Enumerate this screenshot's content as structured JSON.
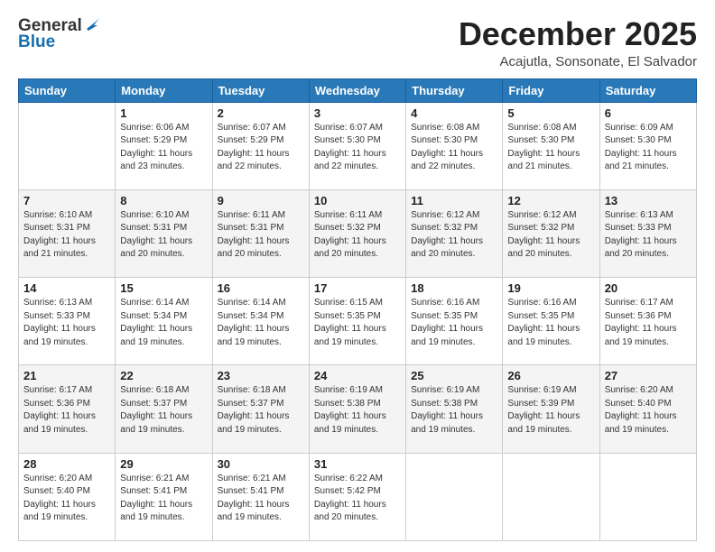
{
  "logo": {
    "line1": "General",
    "line2": "Blue"
  },
  "title": "December 2025",
  "subtitle": "Acajutla, Sonsonate, El Salvador",
  "days_of_week": [
    "Sunday",
    "Monday",
    "Tuesday",
    "Wednesday",
    "Thursday",
    "Friday",
    "Saturday"
  ],
  "weeks": [
    [
      {
        "day": "",
        "info": ""
      },
      {
        "day": "1",
        "info": "Sunrise: 6:06 AM\nSunset: 5:29 PM\nDaylight: 11 hours\nand 23 minutes."
      },
      {
        "day": "2",
        "info": "Sunrise: 6:07 AM\nSunset: 5:29 PM\nDaylight: 11 hours\nand 22 minutes."
      },
      {
        "day": "3",
        "info": "Sunrise: 6:07 AM\nSunset: 5:30 PM\nDaylight: 11 hours\nand 22 minutes."
      },
      {
        "day": "4",
        "info": "Sunrise: 6:08 AM\nSunset: 5:30 PM\nDaylight: 11 hours\nand 22 minutes."
      },
      {
        "day": "5",
        "info": "Sunrise: 6:08 AM\nSunset: 5:30 PM\nDaylight: 11 hours\nand 21 minutes."
      },
      {
        "day": "6",
        "info": "Sunrise: 6:09 AM\nSunset: 5:30 PM\nDaylight: 11 hours\nand 21 minutes."
      }
    ],
    [
      {
        "day": "7",
        "info": "Sunrise: 6:10 AM\nSunset: 5:31 PM\nDaylight: 11 hours\nand 21 minutes."
      },
      {
        "day": "8",
        "info": "Sunrise: 6:10 AM\nSunset: 5:31 PM\nDaylight: 11 hours\nand 20 minutes."
      },
      {
        "day": "9",
        "info": "Sunrise: 6:11 AM\nSunset: 5:31 PM\nDaylight: 11 hours\nand 20 minutes."
      },
      {
        "day": "10",
        "info": "Sunrise: 6:11 AM\nSunset: 5:32 PM\nDaylight: 11 hours\nand 20 minutes."
      },
      {
        "day": "11",
        "info": "Sunrise: 6:12 AM\nSunset: 5:32 PM\nDaylight: 11 hours\nand 20 minutes."
      },
      {
        "day": "12",
        "info": "Sunrise: 6:12 AM\nSunset: 5:32 PM\nDaylight: 11 hours\nand 20 minutes."
      },
      {
        "day": "13",
        "info": "Sunrise: 6:13 AM\nSunset: 5:33 PM\nDaylight: 11 hours\nand 20 minutes."
      }
    ],
    [
      {
        "day": "14",
        "info": "Sunrise: 6:13 AM\nSunset: 5:33 PM\nDaylight: 11 hours\nand 19 minutes."
      },
      {
        "day": "15",
        "info": "Sunrise: 6:14 AM\nSunset: 5:34 PM\nDaylight: 11 hours\nand 19 minutes."
      },
      {
        "day": "16",
        "info": "Sunrise: 6:14 AM\nSunset: 5:34 PM\nDaylight: 11 hours\nand 19 minutes."
      },
      {
        "day": "17",
        "info": "Sunrise: 6:15 AM\nSunset: 5:35 PM\nDaylight: 11 hours\nand 19 minutes."
      },
      {
        "day": "18",
        "info": "Sunrise: 6:16 AM\nSunset: 5:35 PM\nDaylight: 11 hours\nand 19 minutes."
      },
      {
        "day": "19",
        "info": "Sunrise: 6:16 AM\nSunset: 5:35 PM\nDaylight: 11 hours\nand 19 minutes."
      },
      {
        "day": "20",
        "info": "Sunrise: 6:17 AM\nSunset: 5:36 PM\nDaylight: 11 hours\nand 19 minutes."
      }
    ],
    [
      {
        "day": "21",
        "info": "Sunrise: 6:17 AM\nSunset: 5:36 PM\nDaylight: 11 hours\nand 19 minutes."
      },
      {
        "day": "22",
        "info": "Sunrise: 6:18 AM\nSunset: 5:37 PM\nDaylight: 11 hours\nand 19 minutes."
      },
      {
        "day": "23",
        "info": "Sunrise: 6:18 AM\nSunset: 5:37 PM\nDaylight: 11 hours\nand 19 minutes."
      },
      {
        "day": "24",
        "info": "Sunrise: 6:19 AM\nSunset: 5:38 PM\nDaylight: 11 hours\nand 19 minutes."
      },
      {
        "day": "25",
        "info": "Sunrise: 6:19 AM\nSunset: 5:38 PM\nDaylight: 11 hours\nand 19 minutes."
      },
      {
        "day": "26",
        "info": "Sunrise: 6:19 AM\nSunset: 5:39 PM\nDaylight: 11 hours\nand 19 minutes."
      },
      {
        "day": "27",
        "info": "Sunrise: 6:20 AM\nSunset: 5:40 PM\nDaylight: 11 hours\nand 19 minutes."
      }
    ],
    [
      {
        "day": "28",
        "info": "Sunrise: 6:20 AM\nSunset: 5:40 PM\nDaylight: 11 hours\nand 19 minutes."
      },
      {
        "day": "29",
        "info": "Sunrise: 6:21 AM\nSunset: 5:41 PM\nDaylight: 11 hours\nand 19 minutes."
      },
      {
        "day": "30",
        "info": "Sunrise: 6:21 AM\nSunset: 5:41 PM\nDaylight: 11 hours\nand 19 minutes."
      },
      {
        "day": "31",
        "info": "Sunrise: 6:22 AM\nSunset: 5:42 PM\nDaylight: 11 hours\nand 20 minutes."
      },
      {
        "day": "",
        "info": ""
      },
      {
        "day": "",
        "info": ""
      },
      {
        "day": "",
        "info": ""
      }
    ]
  ]
}
